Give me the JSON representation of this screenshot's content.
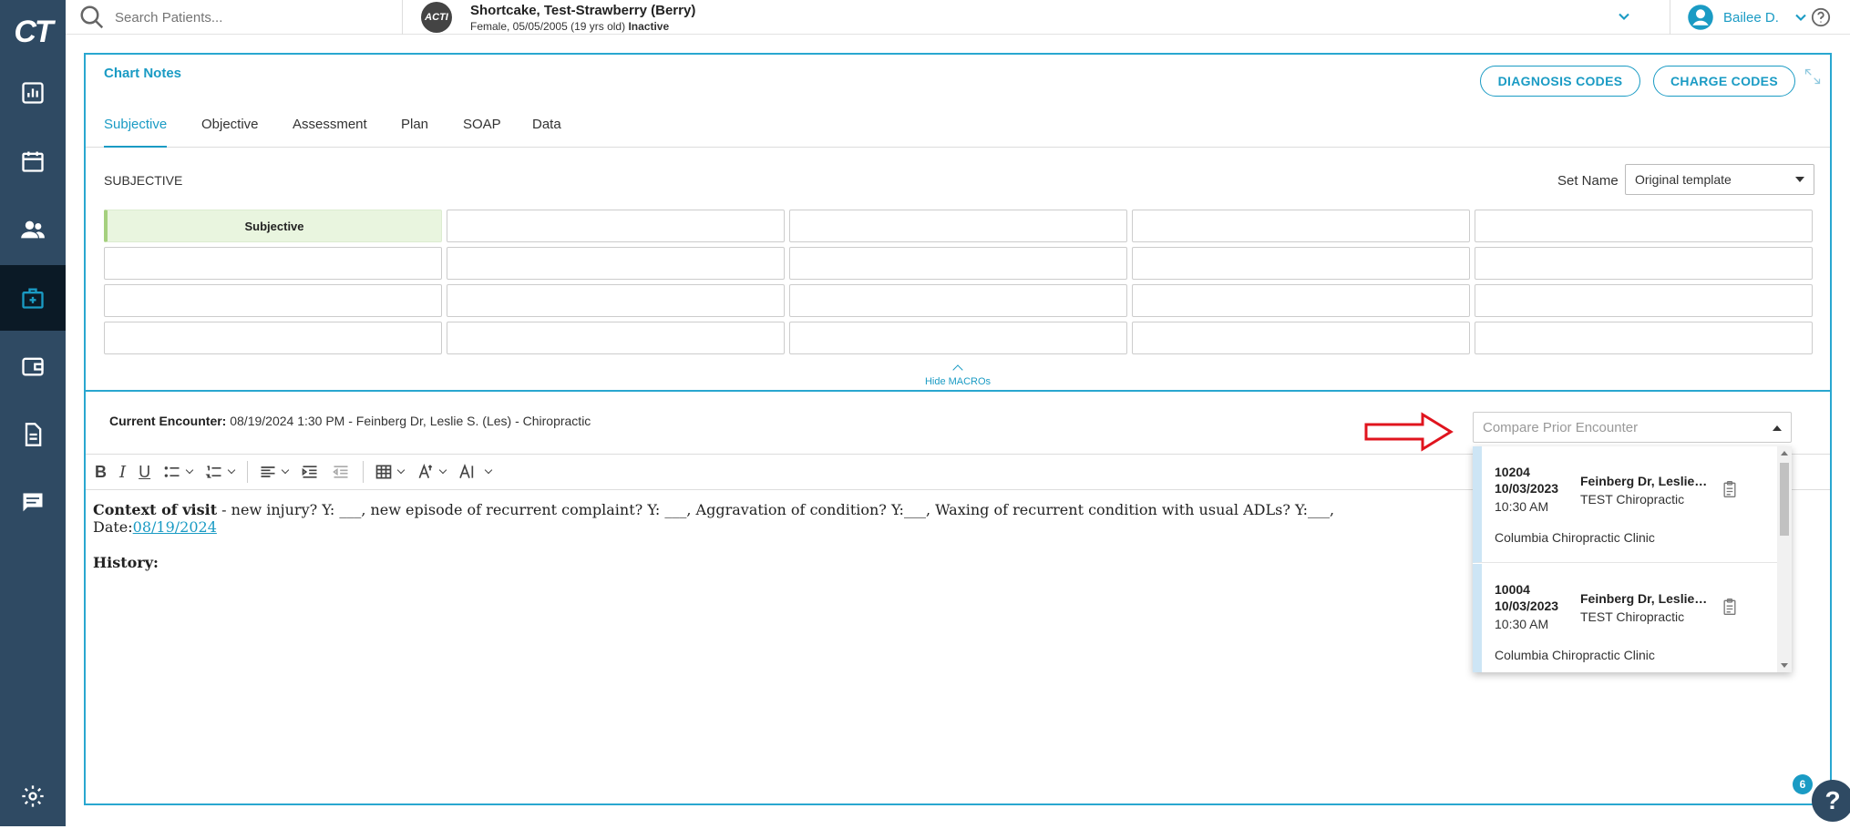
{
  "app": {
    "logo": "CT"
  },
  "search": {
    "placeholder": "Search Patients..."
  },
  "patient": {
    "avatar_text": "ACTI",
    "name": "Shortcake, Test-Strawberry (Berry)",
    "details": "Female, 05/05/2005 (19 yrs old)",
    "status": "Inactive"
  },
  "user": {
    "name": "Bailee D."
  },
  "chart": {
    "title": "Chart Notes",
    "diagnosis_btn": "DIAGNOSIS CODES",
    "charge_btn": "CHARGE CODES"
  },
  "tabs": [
    "Subjective",
    "Objective",
    "Assessment",
    "Plan",
    "SOAP",
    "Data"
  ],
  "section": {
    "label": "SUBJECTIVE",
    "set_name_label": "Set Name",
    "set_name_value": "Original template"
  },
  "macros": {
    "first_cell": "Subjective",
    "hide_label": "Hide MACROs"
  },
  "encounter": {
    "label": "Current Encounter:",
    "value": "08/19/2024 1:30 PM - Feinberg Dr, Leslie S. (Les) - Chiropractic",
    "compare_placeholder": "Compare Prior Encounter"
  },
  "editor": {
    "context_label": "Context of visit",
    "context_text": " - new injury? Y: ___, new episode of recurrent complaint? Y: ___, Aggravation of condition? Y:___, Waxing of recurrent condition with usual ADLs? Y:___, Date:",
    "context_date": "08/19/2024",
    "history_label": "History:"
  },
  "prior_encounters": [
    {
      "id": "10204",
      "date": "10/03/2023",
      "time": "10:30 AM",
      "provider": "Feinberg Dr, Leslie S.",
      "specialty": "TEST Chiropractic",
      "clinic": "Columbia Chiropractic Clinic"
    },
    {
      "id": "10004",
      "date": "10/03/2023",
      "time": "10:30 AM",
      "provider": "Feinberg Dr, Leslie S.",
      "specialty": "TEST Chiropractic",
      "clinic": "Columbia Chiropractic Clinic"
    }
  ],
  "help": {
    "badge": "6",
    "symbol": "?"
  }
}
